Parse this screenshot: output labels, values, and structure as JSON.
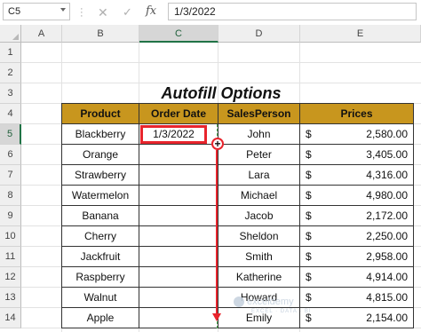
{
  "formula_bar": {
    "name_box": "C5",
    "cancel_glyph": "✕",
    "enter_glyph": "✓",
    "fx_glyph": "fx",
    "formula_value": "1/3/2022"
  },
  "columns": [
    "A",
    "B",
    "C",
    "D",
    "E"
  ],
  "active_column": "C",
  "rows": [
    "1",
    "2",
    "3",
    "4",
    "5",
    "6",
    "7",
    "8",
    "9",
    "10",
    "11",
    "12",
    "13",
    "14"
  ],
  "active_row": "5",
  "title": "Autofill Options",
  "table": {
    "headers": [
      "Product",
      "Order Date",
      "SalesPerson",
      "Prices"
    ],
    "rows": [
      {
        "product": "Blackberry",
        "order_date": "1/3/2022",
        "salesperson": "John",
        "currency": "$",
        "price": "2,580.00"
      },
      {
        "product": "Orange",
        "order_date": "",
        "salesperson": "Peter",
        "currency": "$",
        "price": "3,405.00"
      },
      {
        "product": "Strawberry",
        "order_date": "",
        "salesperson": "Lara",
        "currency": "$",
        "price": "4,316.00"
      },
      {
        "product": "Watermelon",
        "order_date": "",
        "salesperson": "Michael",
        "currency": "$",
        "price": "4,980.00"
      },
      {
        "product": "Banana",
        "order_date": "",
        "salesperson": "Jacob",
        "currency": "$",
        "price": "2,172.00"
      },
      {
        "product": "Cherry",
        "order_date": "",
        "salesperson": "Sheldon",
        "currency": "$",
        "price": "2,250.00"
      },
      {
        "product": "Jackfruit",
        "order_date": "",
        "salesperson": "Smith",
        "currency": "$",
        "price": "2,958.00"
      },
      {
        "product": "Raspberry",
        "order_date": "",
        "salesperson": "Katherine",
        "currency": "$",
        "price": "4,914.00"
      },
      {
        "product": "Walnut",
        "order_date": "",
        "salesperson": "Howard",
        "currency": "$",
        "price": "4,815.00"
      },
      {
        "product": "Apple",
        "order_date": "",
        "salesperson": "Emily",
        "currency": "$",
        "price": "2,154.00"
      }
    ]
  },
  "fill_handle": {
    "glyph": "+"
  },
  "watermark": {
    "text": "exceldemy",
    "subtext": "EXCEL · DATA · BI"
  },
  "colors": {
    "header_fill": "#c8961e",
    "selection_red": "#e8242c",
    "excel_green": "#217346"
  }
}
